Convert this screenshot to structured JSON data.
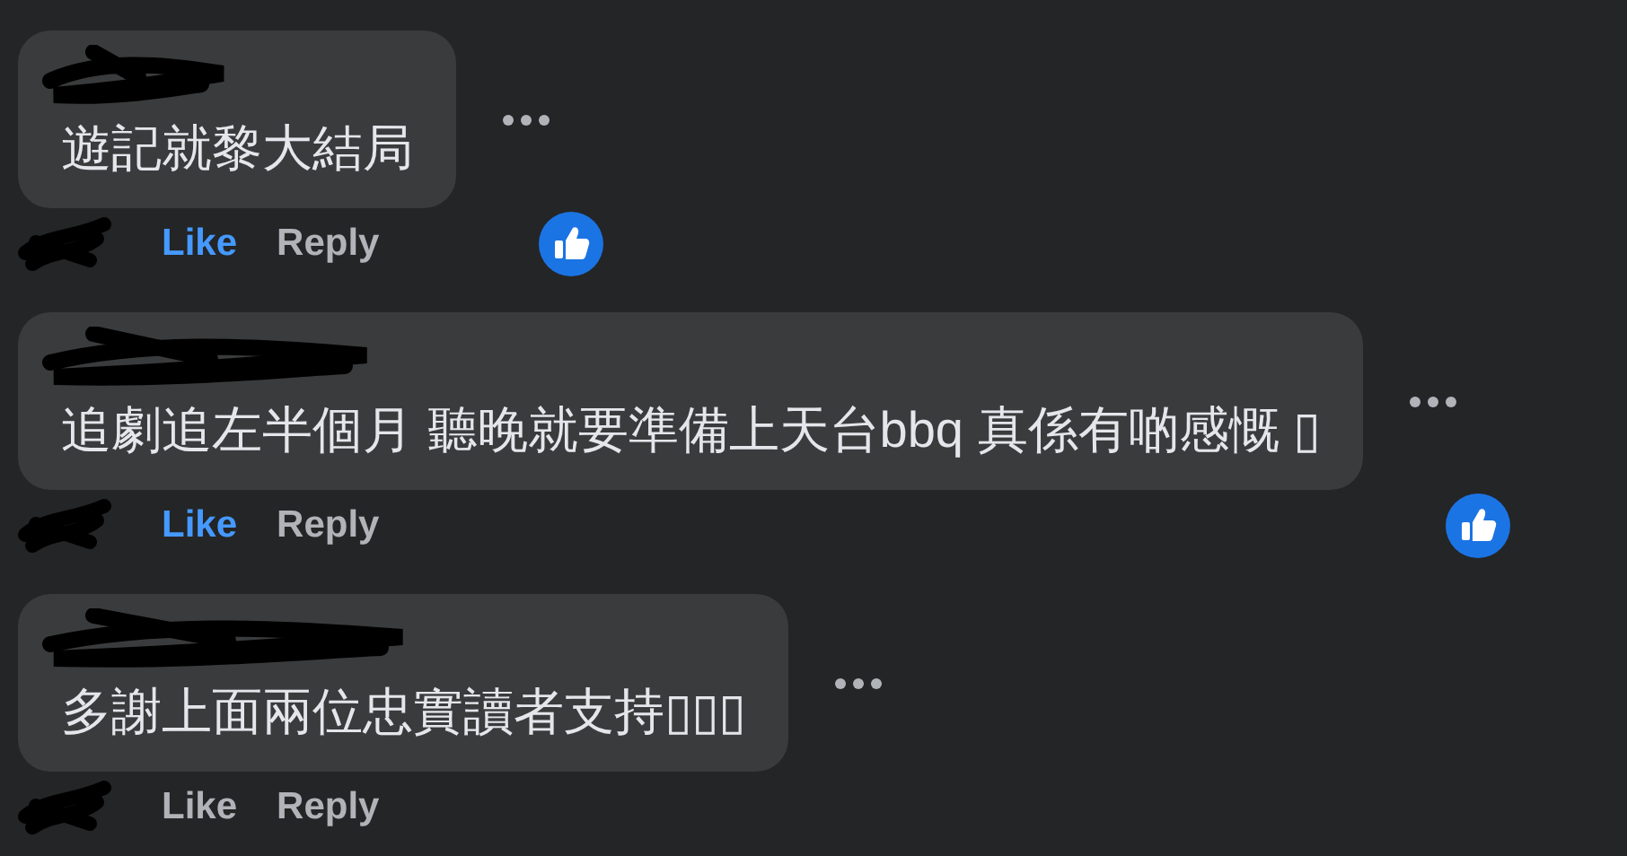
{
  "comments": [
    {
      "text": "遊記就黎大結局",
      "liked": true,
      "reaction": true,
      "actions": {
        "like": "Like",
        "reply": "Reply"
      }
    },
    {
      "text": "追劇追左半個月 聽晚就要準備上天台bbq 真係有啲感慨 ▯",
      "liked": true,
      "reaction": true,
      "actions": {
        "like": "Like",
        "reply": "Reply"
      }
    },
    {
      "text": "多謝上面兩位忠實讀者支持▯▯▯",
      "liked": false,
      "reaction": false,
      "actions": {
        "like": "Like",
        "reply": "Reply"
      }
    }
  ]
}
